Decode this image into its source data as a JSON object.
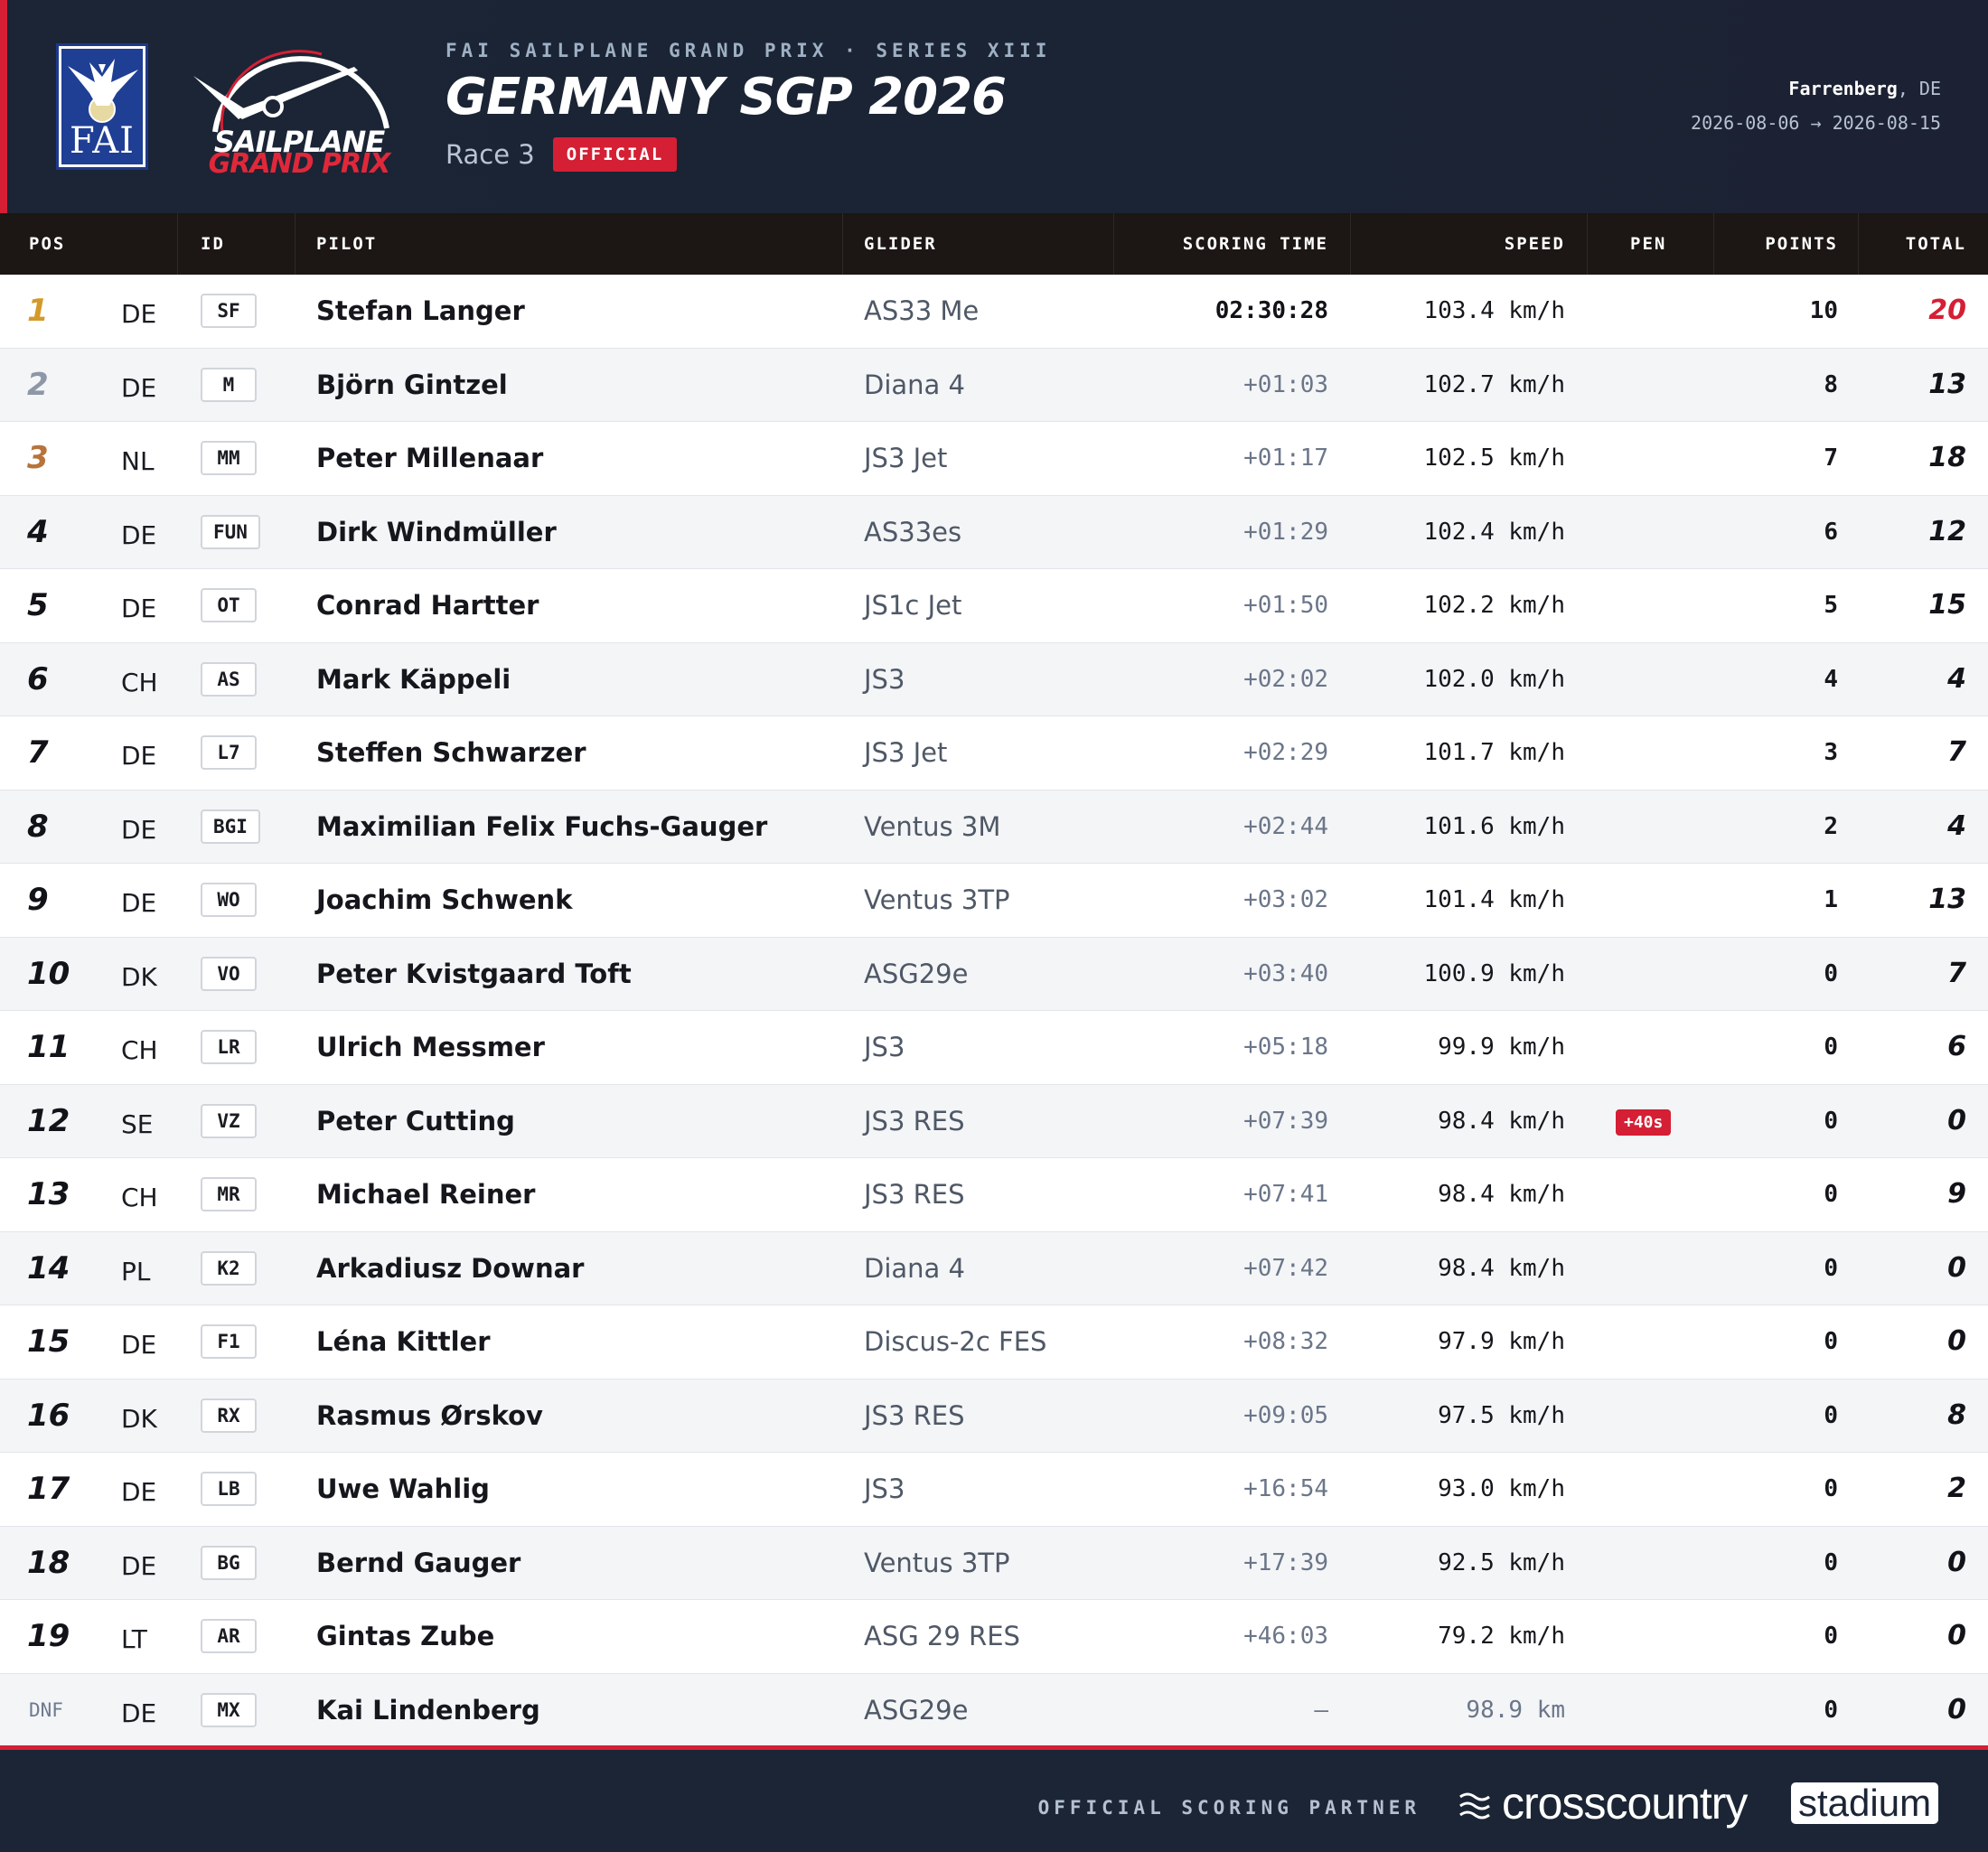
{
  "header": {
    "fai_logo_text": "FAI",
    "sgp_logo_line1": "SAILPLANE",
    "sgp_logo_line2": "GRAND PRIX",
    "series": "FAI SAILPLANE GRAND PRIX · SERIES XIII",
    "title": "GERMANY SGP 2026",
    "race": "Race 3",
    "status_badge": "OFFICIAL",
    "venue_city": "Farrenberg",
    "venue_country": ", DE",
    "dates": "2026-08-06 → 2026-08-15"
  },
  "columns": {
    "pos": "POS",
    "id": "ID",
    "pilot": "PILOT",
    "glider": "GLIDER",
    "scoring_time": "SCORING TIME",
    "speed": "SPEED",
    "pen": "PEN",
    "points": "POINTS",
    "total": "TOTAL"
  },
  "rows": [
    {
      "pos": "1",
      "nat": "DE",
      "id": "SF",
      "pilot": "Stefan Langer",
      "glider": "AS33 Me",
      "time": "02:30:28",
      "speed": "103.4 km/h",
      "pen": "",
      "points": "10",
      "total": "20"
    },
    {
      "pos": "2",
      "nat": "DE",
      "id": "M",
      "pilot": "Björn Gintzel",
      "glider": "Diana 4",
      "time": "+01:03",
      "speed": "102.7 km/h",
      "pen": "",
      "points": "8",
      "total": "13"
    },
    {
      "pos": "3",
      "nat": "NL",
      "id": "MM",
      "pilot": "Peter Millenaar",
      "glider": "JS3 Jet",
      "time": "+01:17",
      "speed": "102.5 km/h",
      "pen": "",
      "points": "7",
      "total": "18"
    },
    {
      "pos": "4",
      "nat": "DE",
      "id": "FUN",
      "pilot": "Dirk Windmüller",
      "glider": "AS33es",
      "time": "+01:29",
      "speed": "102.4 km/h",
      "pen": "",
      "points": "6",
      "total": "12"
    },
    {
      "pos": "5",
      "nat": "DE",
      "id": "OT",
      "pilot": "Conrad Hartter",
      "glider": "JS1c Jet",
      "time": "+01:50",
      "speed": "102.2 km/h",
      "pen": "",
      "points": "5",
      "total": "15"
    },
    {
      "pos": "6",
      "nat": "CH",
      "id": "AS",
      "pilot": "Mark Käppeli",
      "glider": "JS3",
      "time": "+02:02",
      "speed": "102.0 km/h",
      "pen": "",
      "points": "4",
      "total": "4"
    },
    {
      "pos": "7",
      "nat": "DE",
      "id": "L7",
      "pilot": "Steffen Schwarzer",
      "glider": "JS3 Jet",
      "time": "+02:29",
      "speed": "101.7 km/h",
      "pen": "",
      "points": "3",
      "total": "7"
    },
    {
      "pos": "8",
      "nat": "DE",
      "id": "BGI",
      "pilot": "Maximilian Felix Fuchs-Gauger",
      "glider": "Ventus 3M",
      "time": "+02:44",
      "speed": "101.6 km/h",
      "pen": "",
      "points": "2",
      "total": "4"
    },
    {
      "pos": "9",
      "nat": "DE",
      "id": "WO",
      "pilot": "Joachim Schwenk",
      "glider": "Ventus 3TP",
      "time": "+03:02",
      "speed": "101.4 km/h",
      "pen": "",
      "points": "1",
      "total": "13"
    },
    {
      "pos": "10",
      "nat": "DK",
      "id": "VO",
      "pilot": "Peter Kvistgaard Toft",
      "glider": "ASG29e",
      "time": "+03:40",
      "speed": "100.9 km/h",
      "pen": "",
      "points": "0",
      "total": "7"
    },
    {
      "pos": "11",
      "nat": "CH",
      "id": "LR",
      "pilot": "Ulrich Messmer",
      "glider": "JS3",
      "time": "+05:18",
      "speed": "99.9 km/h",
      "pen": "",
      "points": "0",
      "total": "6"
    },
    {
      "pos": "12",
      "nat": "SE",
      "id": "VZ",
      "pilot": "Peter Cutting",
      "glider": "JS3 RES",
      "time": "+07:39",
      "speed": "98.4 km/h",
      "pen": "+40s",
      "points": "0",
      "total": "0"
    },
    {
      "pos": "13",
      "nat": "CH",
      "id": "MR",
      "pilot": "Michael Reiner",
      "glider": "JS3 RES",
      "time": "+07:41",
      "speed": "98.4 km/h",
      "pen": "",
      "points": "0",
      "total": "9"
    },
    {
      "pos": "14",
      "nat": "PL",
      "id": "K2",
      "pilot": "Arkadiusz Downar",
      "glider": "Diana 4",
      "time": "+07:42",
      "speed": "98.4 km/h",
      "pen": "",
      "points": "0",
      "total": "0"
    },
    {
      "pos": "15",
      "nat": "DE",
      "id": "F1",
      "pilot": "Léna Kittler",
      "glider": "Discus-2c FES",
      "time": "+08:32",
      "speed": "97.9 km/h",
      "pen": "",
      "points": "0",
      "total": "0"
    },
    {
      "pos": "16",
      "nat": "DK",
      "id": "RX",
      "pilot": "Rasmus Ørskov",
      "glider": "JS3 RES",
      "time": "+09:05",
      "speed": "97.5 km/h",
      "pen": "",
      "points": "0",
      "total": "8"
    },
    {
      "pos": "17",
      "nat": "DE",
      "id": "LB",
      "pilot": "Uwe Wahlig",
      "glider": "JS3",
      "time": "+16:54",
      "speed": "93.0 km/h",
      "pen": "",
      "points": "0",
      "total": "2"
    },
    {
      "pos": "18",
      "nat": "DE",
      "id": "BG",
      "pilot": "Bernd Gauger",
      "glider": "Ventus 3TP",
      "time": "+17:39",
      "speed": "92.5 km/h",
      "pen": "",
      "points": "0",
      "total": "0"
    },
    {
      "pos": "19",
      "nat": "LT",
      "id": "AR",
      "pilot": "Gintas Zube",
      "glider": "ASG 29 RES",
      "time": "+46:03",
      "speed": "79.2 km/h",
      "pen": "",
      "points": "0",
      "total": "0"
    },
    {
      "pos": "DNF",
      "nat": "DE",
      "id": "MX",
      "pilot": "Kai Lindenberg",
      "glider": "ASG29e",
      "time": "–",
      "speed": "98.9 km",
      "pen": "",
      "points": "0",
      "total": "0"
    }
  ],
  "footer": {
    "partner_label": "OFFICIAL SCORING PARTNER",
    "brand_word": "crosscountry",
    "brand_badge": "stadium"
  },
  "colors": {
    "accent_red": "#d41f34",
    "header_navy": "#1b2535",
    "gold": "#d39a2a",
    "silver": "#8d97a7",
    "bronze": "#b8733a"
  },
  "icons": {
    "fai_logo": "fai-eagle-globe-emblem",
    "sgp_logo": "sailplane-arc-emblem",
    "brand_icon": "crosscountry-wind-icon"
  }
}
